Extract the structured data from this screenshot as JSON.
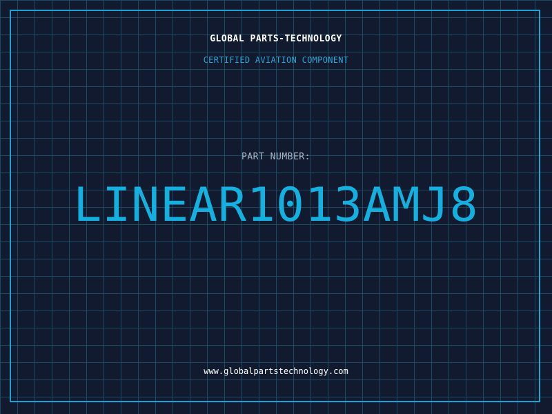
{
  "header": {
    "brand": "GLOBAL PARTS-TECHNOLOGY",
    "subtitle": "CERTIFIED AVIATION COMPONENT"
  },
  "part": {
    "label": "PART NUMBER:",
    "number": "LINEAR1013AMJ8"
  },
  "footer": {
    "url": "www.globalpartstechnology.com"
  },
  "colors": {
    "background": "#111a2e",
    "grid": "#1c4a63",
    "accent": "#14b1e0",
    "frame": "#1aa3d4"
  }
}
